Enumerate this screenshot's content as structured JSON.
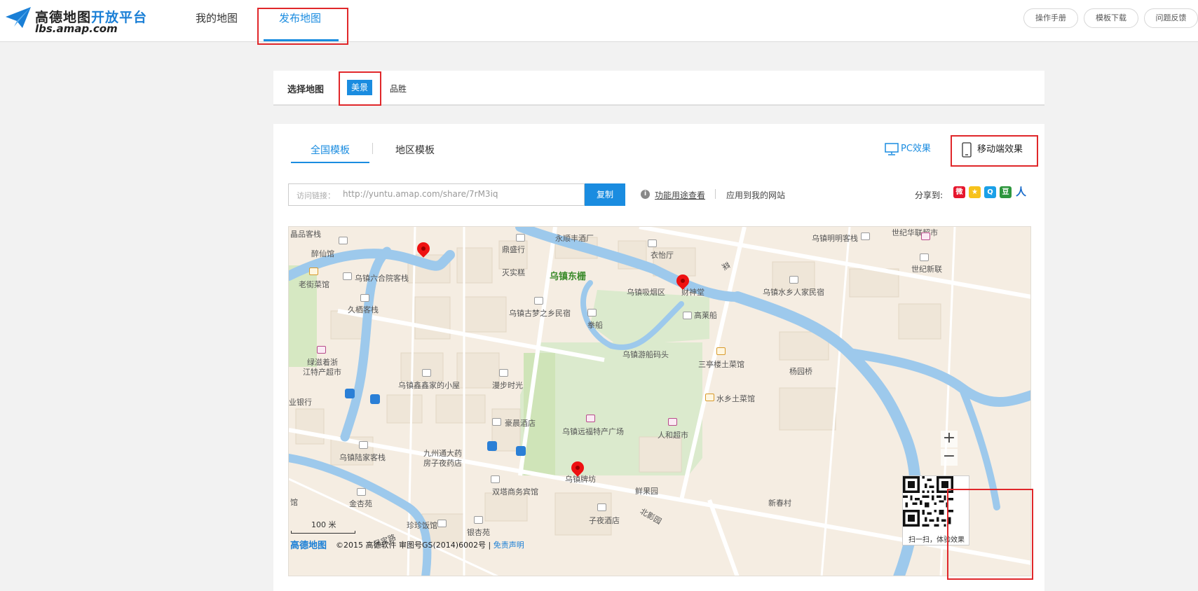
{
  "header": {
    "logo_cn_dark": "高德地图",
    "logo_cn_blue": "开放平台",
    "logo_en": "lbs.amap.com",
    "nav": [
      "我的地图",
      "发布地图"
    ],
    "right_buttons": [
      "操作手册",
      "模板下载",
      "问题反馈"
    ]
  },
  "select_map": {
    "label": "选择地图",
    "options": [
      "美景",
      "品胜"
    ],
    "selected": "美景"
  },
  "main": {
    "tabs": [
      "全国模板",
      "地区模板"
    ],
    "view_pc": "PC效果",
    "view_mobile": "移动端效果",
    "link_label": "访问链接：",
    "link_url": "http://yuntu.amap.com/share/7rM3iq",
    "copy_btn": "复制",
    "func_link": "功能用途查看",
    "apply_link": "应用到我的网站",
    "share_label": "分享到:",
    "share_icons": [
      "weibo-icon",
      "qzone-icon",
      "qq-icon",
      "douban-icon",
      "renren-icon"
    ]
  },
  "map": {
    "labels": {
      "l1": "晶品客栈",
      "l2": "醉仙馆",
      "l3": "老街菜馆",
      "l4": "乌镇六合院客栈",
      "l5": "久栖客栈",
      "l6": "绿滋着浙",
      "l7": "江特产超市",
      "l8": "业银行",
      "l9": "乌镇鑫鑫家的小屋",
      "l10": "漫步时光",
      "l11": "鼎盛行",
      "l12": "永顺丰酒厂",
      "l13": "衣怡厅",
      "l14": "灭实糕",
      "l15": "乌镇东栅",
      "l16": "乌镇吸烟区",
      "l17": "财神堂",
      "l18": "乌镇古梦之乡民宿",
      "l19": "拳船",
      "l20": "高莱船",
      "l21": "乌镇游船码头",
      "l22": "三亭楼土菜馆",
      "l23": "杨园桥",
      "l24": "水乡土菜馆",
      "l25": "豪晨酒店",
      "l26": "乌镇远福特产广场",
      "l27": "人和超市",
      "l28": "九州通大药",
      "l29": "房子夜药店",
      "l30": "乌镇陆家客栈",
      "l31": "乌镇牌坊",
      "l32": "双塔商务宾馆",
      "l33": "鲜果园",
      "l34": "金杏苑",
      "l35": "珍珍饭馆",
      "l36": "银杏苑",
      "l37": "子夜酒店",
      "l38": "乌镇明明客栈",
      "l39": "世纪华联超市",
      "l40": "世纪新联",
      "l41": "乌镇水乡人家民宿",
      "l42": "新春村",
      "l43": "馆",
      "l44": "菜",
      "l45": "北影园",
      "l46": "兄宝路"
    },
    "scale": "100 米",
    "logo": "高德地图",
    "copyright": "©2015 高德软件 审图号GS(2014)6002号 |",
    "disclaimer": "免责声明",
    "qr_caption": "扫一扫，体验效果"
  },
  "colors": {
    "accent": "#1a8ce0",
    "highlight": "#e0272a",
    "water": "#9dc9ec",
    "green": "#d8e9c8"
  }
}
